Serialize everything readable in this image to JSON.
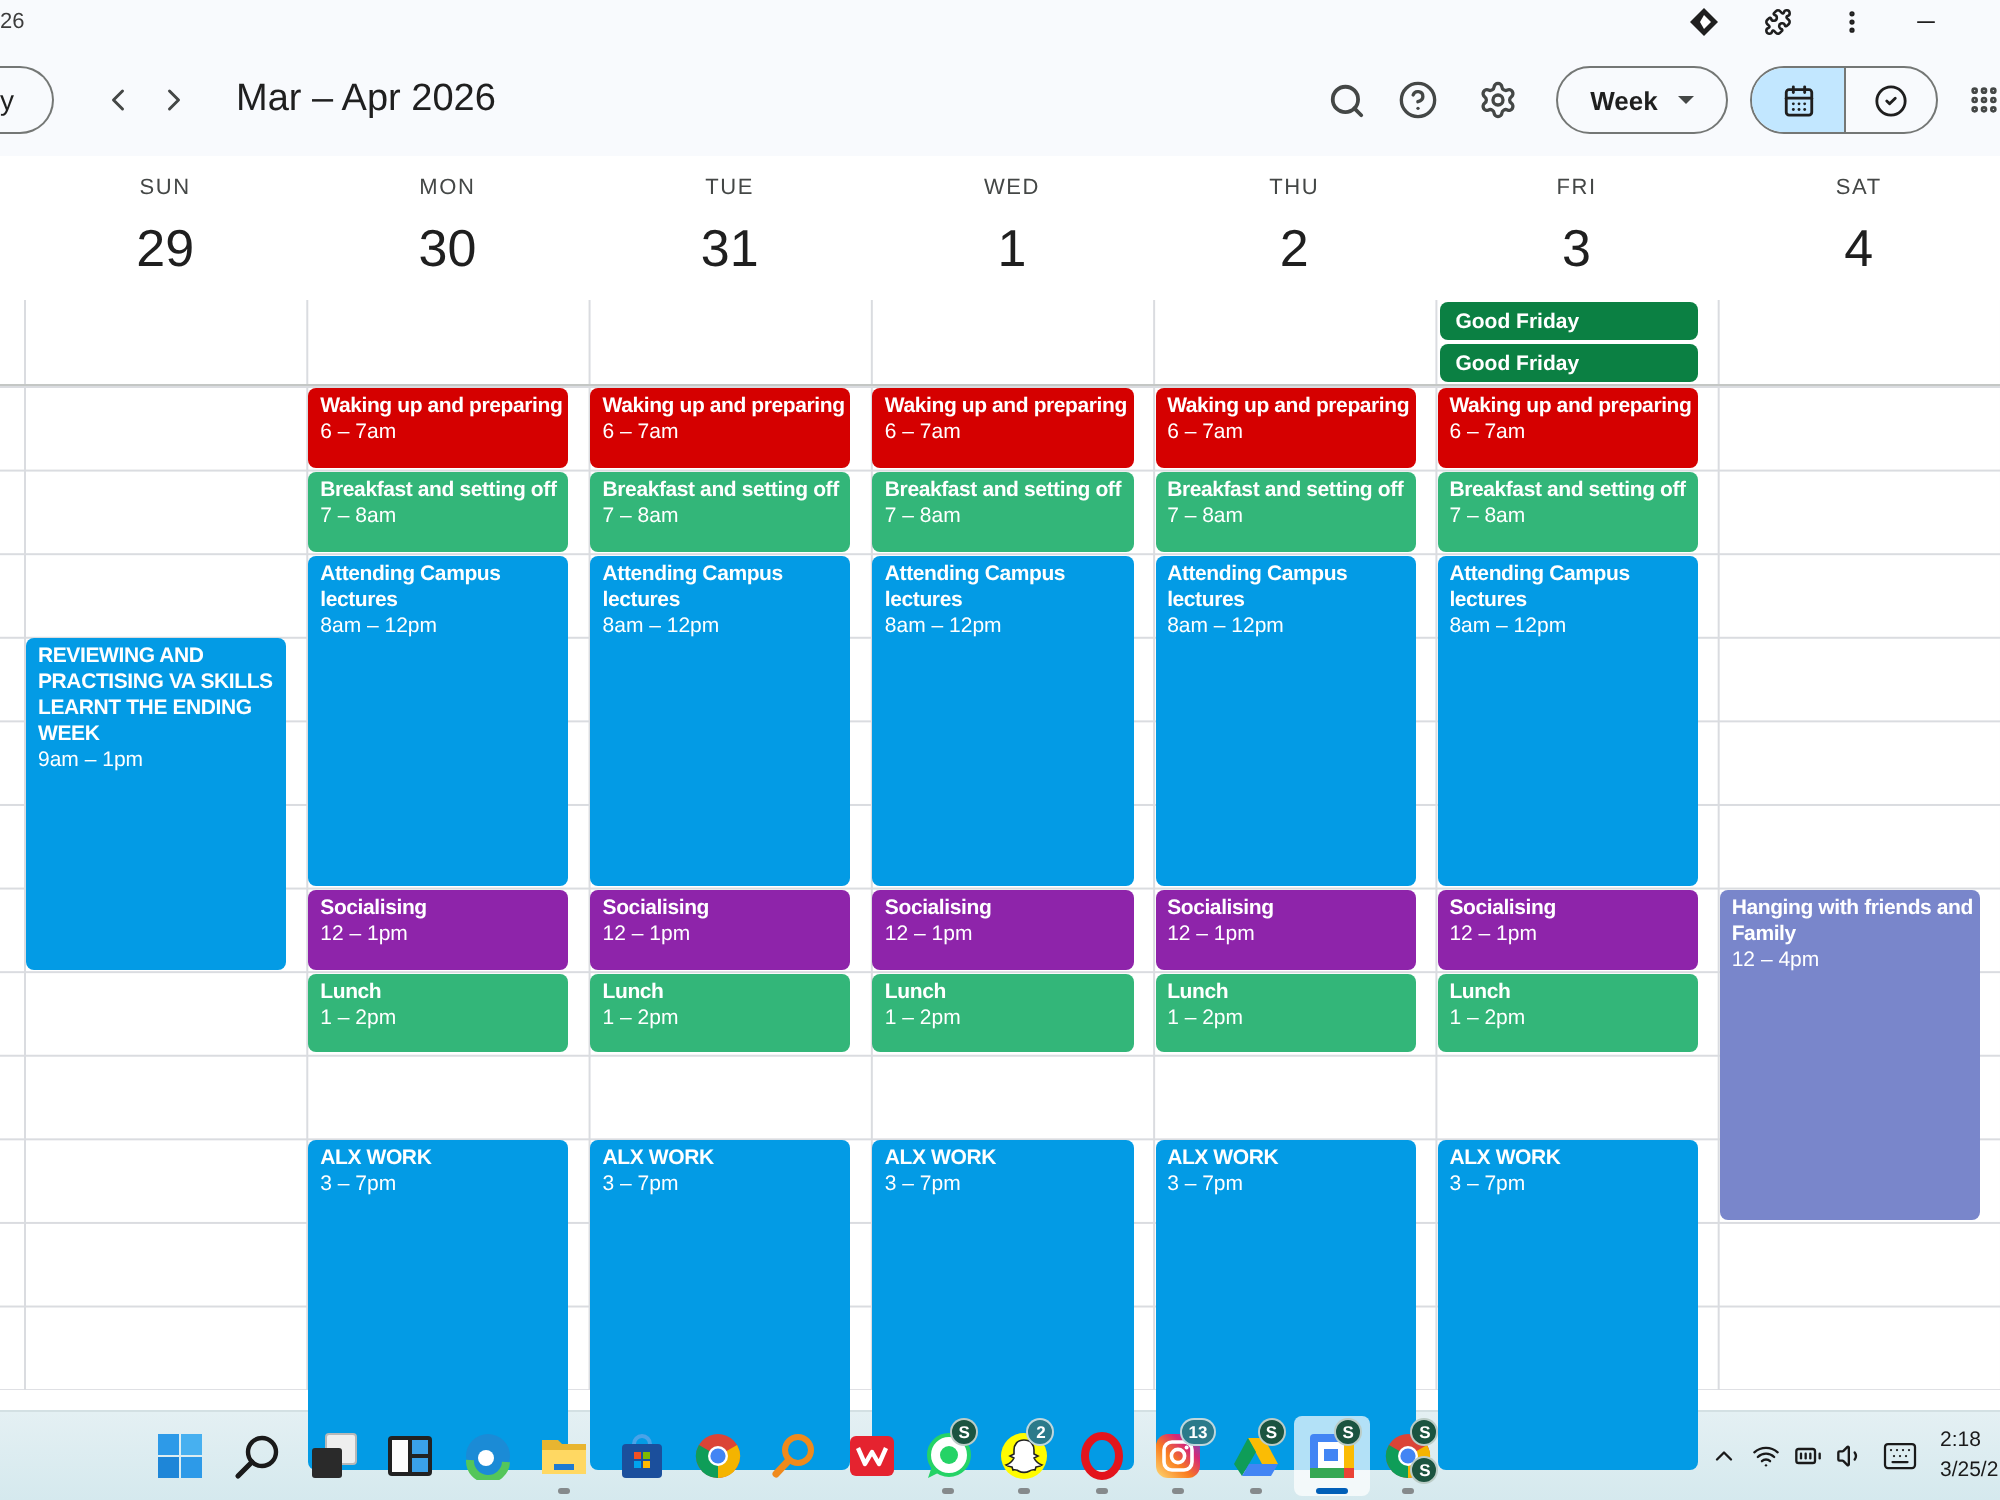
{
  "window": {
    "title_fragment": "26"
  },
  "toolbar": {
    "today_button": "y",
    "title": "Mar – Apr 2026",
    "view_dropdown": "Week",
    "view_toggle": [
      {
        "kind": "calendar",
        "selected": true
      },
      {
        "kind": "tasks",
        "selected": false
      }
    ]
  },
  "days": [
    {
      "weekday": "SUN",
      "date": "29",
      "events": [
        {
          "title": "REVIEWING AND PRACTISING VA SKILLS LEARNT THE ENDING WEEK",
          "time": "9am – 1pm",
          "color": "#039be5"
        }
      ]
    },
    {
      "weekday": "MON",
      "date": "30",
      "events": [
        {
          "title": "Waking up and preparing",
          "time": "6 – 7am",
          "color": "#d50000"
        },
        {
          "title": "Breakfast and setting off",
          "time": "7 – 8am",
          "color": "#33b679"
        },
        {
          "title": "Attending Campus lectures",
          "time": "8am – 12pm",
          "color": "#039be5"
        },
        {
          "title": "Socialising",
          "time": "12 – 1pm",
          "color": "#8e24aa"
        },
        {
          "title": "Lunch",
          "time": "1 – 2pm",
          "color": "#33b679"
        },
        {
          "title": "ALX WORK",
          "time": "3 – 7pm",
          "color": "#039be5"
        }
      ]
    },
    {
      "weekday": "TUE",
      "date": "31",
      "events": [
        {
          "title": "Waking up and preparing",
          "time": "6 – 7am",
          "color": "#d50000"
        },
        {
          "title": "Breakfast and setting off",
          "time": "7 – 8am",
          "color": "#33b679"
        },
        {
          "title": "Attending Campus lectures",
          "time": "8am – 12pm",
          "color": "#039be5"
        },
        {
          "title": "Socialising",
          "time": "12 – 1pm",
          "color": "#8e24aa"
        },
        {
          "title": "Lunch",
          "time": "1 – 2pm",
          "color": "#33b679"
        },
        {
          "title": "ALX WORK",
          "time": "3 – 7pm",
          "color": "#039be5"
        }
      ]
    },
    {
      "weekday": "WED",
      "date": "1",
      "events": [
        {
          "title": "Waking up and preparing",
          "time": "6 – 7am",
          "color": "#d50000"
        },
        {
          "title": "Breakfast and setting off",
          "time": "7 – 8am",
          "color": "#33b679"
        },
        {
          "title": "Attending Campus lectures",
          "time": "8am – 12pm",
          "color": "#039be5"
        },
        {
          "title": "Socialising",
          "time": "12 – 1pm",
          "color": "#8e24aa"
        },
        {
          "title": "Lunch",
          "time": "1 – 2pm",
          "color": "#33b679"
        },
        {
          "title": "ALX WORK",
          "time": "3 – 7pm",
          "color": "#039be5"
        }
      ]
    },
    {
      "weekday": "THU",
      "date": "2",
      "events": [
        {
          "title": "Waking up and preparing",
          "time": "6 – 7am",
          "color": "#d50000"
        },
        {
          "title": "Breakfast and setting off",
          "time": "7 – 8am",
          "color": "#33b679"
        },
        {
          "title": "Attending Campus lectures",
          "time": "8am – 12pm",
          "color": "#039be5"
        },
        {
          "title": "Socialising",
          "time": "12 – 1pm",
          "color": "#8e24aa"
        },
        {
          "title": "Lunch",
          "time": "1 – 2pm",
          "color": "#33b679"
        },
        {
          "title": "ALX WORK",
          "time": "3 – 7pm",
          "color": "#039be5"
        }
      ]
    },
    {
      "weekday": "FRI",
      "date": "3",
      "all_day": [
        {
          "title": "Good Friday",
          "color": "#0b8043"
        },
        {
          "title": "Good Friday",
          "color": "#0b8043"
        }
      ],
      "events": [
        {
          "title": "Waking up and preparing",
          "time": "6 – 7am",
          "color": "#d50000"
        },
        {
          "title": "Breakfast and setting off",
          "time": "7 – 8am",
          "color": "#33b679"
        },
        {
          "title": "Attending Campus lectures",
          "time": "8am – 12pm",
          "color": "#039be5"
        },
        {
          "title": "Socialising",
          "time": "12 – 1pm",
          "color": "#8e24aa"
        },
        {
          "title": "Lunch",
          "time": "1 – 2pm",
          "color": "#33b679"
        },
        {
          "title": "ALX WORK",
          "time": "3 – 7pm",
          "color": "#039be5"
        }
      ]
    },
    {
      "weekday": "SAT",
      "date": "4",
      "events": [
        {
          "title": "Hanging with friends and Family",
          "time": "12 – 4pm",
          "color": "#7986cb"
        }
      ]
    }
  ],
  "taskbar": {
    "apps": [
      {
        "kind": "start",
        "running": false,
        "active": false
      },
      {
        "kind": "search",
        "running": false,
        "active": false
      },
      {
        "kind": "task_view",
        "running": false,
        "active": false
      },
      {
        "kind": "widgets",
        "running": false,
        "active": false
      },
      {
        "kind": "swirl",
        "running": false,
        "active": false
      },
      {
        "kind": "folder",
        "running": true,
        "active": false
      },
      {
        "kind": "bag",
        "running": false,
        "active": false
      },
      {
        "kind": "tricolor",
        "running": false,
        "active": false
      },
      {
        "kind": "magnifier",
        "running": false,
        "active": false
      },
      {
        "kind": "zigzag",
        "running": false,
        "active": false
      },
      {
        "kind": "chat",
        "running": true,
        "active": false,
        "badges": [
          {
            "kind": "profile",
            "text": "S"
          }
        ]
      },
      {
        "kind": "ghost",
        "running": true,
        "active": false,
        "badges": [
          {
            "kind": "count",
            "text": "2"
          }
        ]
      },
      {
        "kind": "ring",
        "running": true,
        "active": false
      },
      {
        "kind": "camera",
        "running": true,
        "active": false,
        "badges": [
          {
            "kind": "count",
            "text": "13"
          }
        ]
      },
      {
        "kind": "triangle",
        "running": true,
        "active": false,
        "badges": [
          {
            "kind": "profile",
            "text": "S"
          }
        ]
      },
      {
        "kind": "calendar",
        "running": true,
        "active": true,
        "badges": [
          {
            "kind": "profile",
            "text": "S"
          }
        ]
      },
      {
        "kind": "tricolor",
        "running": true,
        "active": false,
        "badges": [
          {
            "kind": "profile",
            "text": "S"
          },
          {
            "kind": "profile",
            "text": "S"
          }
        ]
      }
    ],
    "tray": {
      "time": "2:18",
      "date": "3/25/2"
    }
  }
}
